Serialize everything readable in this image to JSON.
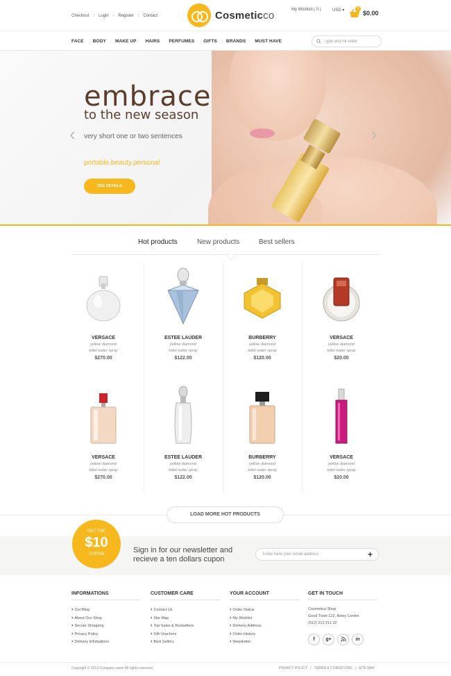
{
  "header": {
    "links": [
      "Checkout",
      "Login",
      "Register",
      "Contact"
    ],
    "logo_main": "Cosmetic",
    "logo_suffix": "co",
    "wishlist": "My Wishlist ( 0 )",
    "currency": "USD ▾",
    "cart_count": "0",
    "cart_total": "$0.00"
  },
  "nav": {
    "items": [
      "FACE",
      "BODY",
      "MAKE UP",
      "HAIRS",
      "PERFUMES",
      "GIFTS",
      "BRANDS",
      "MUST HAVE"
    ],
    "search_placeholder": "Type and hit enter"
  },
  "hero": {
    "title": "embrace",
    "subtitle": "to the new season",
    "description": "very short one or two sentences",
    "tagline": "portable.beauty.personal",
    "button": "SEE DETAILS"
  },
  "tabs": [
    "Hot products",
    "New products",
    "Best sellers"
  ],
  "products": [
    {
      "name": "VERSACE",
      "desc1": "yellow diamond",
      "desc2": "toilet water spray",
      "price": "$270.00",
      "image": "white-round-perfume"
    },
    {
      "name": "ESTEE LAUDER",
      "desc1": "yellow diamond",
      "desc2": "toilet water spray",
      "price": "$122.00",
      "image": "diamond-perfume"
    },
    {
      "name": "BURBERRY",
      "desc1": "yellow diamond",
      "desc2": "toilet water spray",
      "price": "$120.00",
      "image": "gold-hexagon-perfume"
    },
    {
      "name": "VERSACE",
      "desc1": "yellow diamond",
      "desc2": "toilet water spray",
      "price": "$20.00",
      "image": "red-disc-perfume"
    },
    {
      "name": "VERSACE",
      "desc1": "yellow diamond",
      "desc2": "toilet water spray",
      "price": "$270.00",
      "image": "red-cap-perfume"
    },
    {
      "name": "ESTEE LAUDER",
      "desc1": "yellow diamond",
      "desc2": "toilet water spray",
      "price": "$122.00",
      "image": "silver-slim-perfume"
    },
    {
      "name": "BURBERRY",
      "desc1": "yellow diamond",
      "desc2": "toilet water spray",
      "price": "$120.00",
      "image": "black-cap-perfume"
    },
    {
      "name": "VERSACE",
      "desc1": "yellow diamond",
      "desc2": "toilet water spray",
      "price": "$20.00",
      "image": "pink-tall-perfume"
    }
  ],
  "load_more": "LOAD MORE HOT PRODUCTS",
  "newsletter": {
    "badge_top": "GET THE",
    "badge_amount": "$10",
    "badge_bottom": "CUPON",
    "line1": "Sign in for our newsletter and",
    "line2": "recieve a ten dollars cupon",
    "placeholder": "Enter here your email address",
    "submit": "+"
  },
  "footer": {
    "informations": {
      "title": "INFORMATIONS",
      "items": [
        "Our Blog",
        "About Our Shop",
        "Secure Shopping",
        "Privacy Policy",
        "Delivery Infomations"
      ]
    },
    "customer_care": {
      "title": "CUSTOMER CARE",
      "items": [
        "Contact Us",
        "Site Map",
        "Top Sales & Bestsellers",
        "Gift Vouchers",
        "Best Sellers"
      ]
    },
    "your_account": {
      "title": "YOUR ACCOUNT",
      "items": [
        "Order Status",
        "My Wishlist",
        "Delivery Address",
        "Order History",
        "Newsletter"
      ]
    },
    "get_in_touch": {
      "title": "GET IN TOUCH",
      "lines": [
        "Cosmetico Shop",
        "Good Town 122, Beley Centre",
        "(012) 212 211 22"
      ]
    },
    "socials": [
      "f",
      "g+",
      "rss",
      "in"
    ],
    "copyright": "Copyright © 2013 Company name All rights reserved",
    "bottom_links": [
      "PRIVACY POLICY",
      "TERMS & CONDITIONS",
      "SITE MAP"
    ]
  },
  "colors": {
    "accent": "#f6b81c",
    "text": "#444444",
    "heading": "#5b3d2e"
  }
}
